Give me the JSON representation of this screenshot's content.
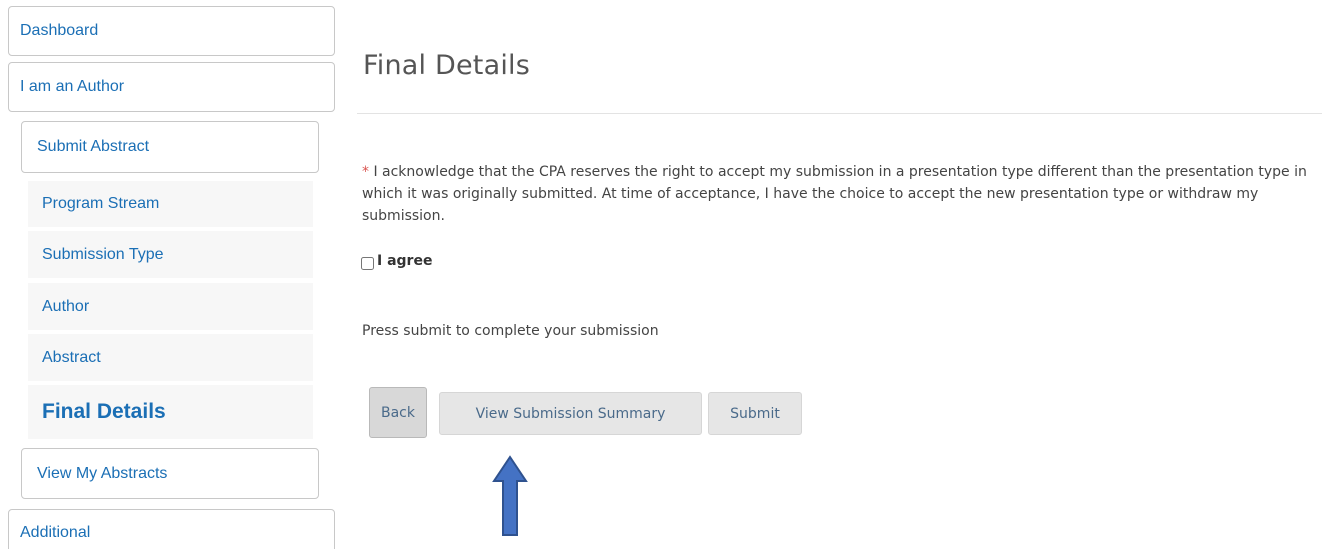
{
  "sidebar": {
    "dashboard": "Dashboard",
    "author": "I am an Author",
    "submit_abstract": "Submit Abstract",
    "steps": [
      "Program Stream",
      "Submission Type",
      "Author",
      "Abstract",
      "Final Details"
    ],
    "view_abstracts": "View My Abstracts",
    "additional": "Additional"
  },
  "main": {
    "title": "Final Details",
    "required_marker": "*",
    "acknowledgement": " I acknowledge that the CPA reserves the right to accept my submission in a presentation type different than the presentation type in which it was originally submitted. At time of acceptance, I have the choice to accept the new presentation type or withdraw my submission.",
    "agree_label": "I agree",
    "instruction": "Press submit to complete your submission",
    "buttons": {
      "back": "Back",
      "view_summary": "View Submission Summary",
      "submit": "Submit"
    }
  },
  "colors": {
    "link": "#1b6fb5",
    "required": "#d9534f",
    "arrow": "#4472c4"
  },
  "icons": {
    "annotation_arrow": "up-arrow-icon"
  }
}
